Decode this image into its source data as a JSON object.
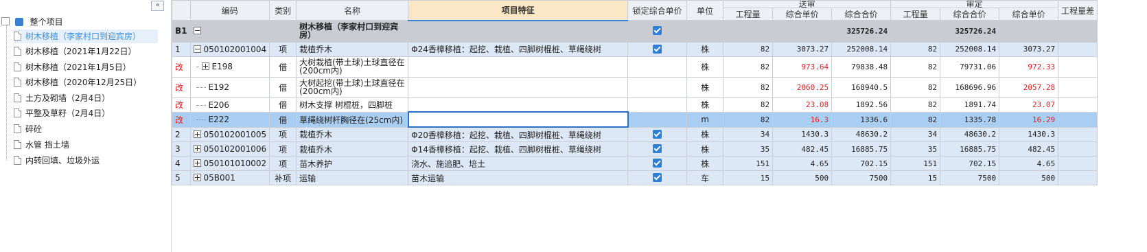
{
  "tree": {
    "collapse_glyph": "«",
    "root": "整个项目",
    "items": [
      "树木移植（李家村口到迎宾房）",
      "树木移植（2021年1月22日）",
      "树木移植（2021年1月5日）",
      "树木移植（2020年12月25日）",
      "土方及砌墙（2月4日）",
      "平整及草籽（2月4日）",
      "碎砼",
      "水管 挡土墙",
      "内转回填、垃圾外运"
    ]
  },
  "grid": {
    "headers": {
      "code": "编码",
      "type": "类别",
      "name": "名称",
      "feature": "项目特征",
      "lock": "锁定综合单价",
      "unit": "单位",
      "group1": "送审",
      "group2": "审定",
      "qty": "工程量",
      "uprice": "综合单价",
      "total": "综合合价",
      "extra": "工程量差"
    },
    "b1": {
      "code": "B1",
      "name": "树木移植（李家村口到迎宾房）",
      "total1": "325726.24",
      "total2": "325726.24"
    },
    "rows": [
      {
        "no": "1",
        "code": "050102001004",
        "type": "项",
        "name": "栽植乔木",
        "feature": "Φ24香樟移植：起挖、栽植、四脚树棍桩、草绳绕树",
        "unit": "株",
        "q1": "82",
        "p1": "3073.27",
        "t1": "252008.14",
        "q2": "82",
        "t2": "252008.14",
        "p2": "3073.27"
      },
      {
        "no": "改",
        "code": "E198",
        "type": "借",
        "name": "大树栽植(带土球)土球直径在(200cm内)",
        "feature": "",
        "unit": "株",
        "q1": "82",
        "p1": "973.64",
        "t1": "79838.48",
        "q2": "82",
        "t2": "79731.06",
        "p2": "972.33"
      },
      {
        "no": "改",
        "code": "E192",
        "type": "借",
        "name": "大树起挖(带土球)土球直径在(200cm内)",
        "feature": "",
        "unit": "株",
        "q1": "82",
        "p1": "2060.25",
        "t1": "168940.5",
        "q2": "82",
        "t2": "168696.96",
        "p2": "2057.28"
      },
      {
        "no": "改",
        "code": "E206",
        "type": "借",
        "name": "树木支撑 树棍桩，四脚桩",
        "feature": "",
        "unit": "株",
        "q1": "82",
        "p1": "23.08",
        "t1": "1892.56",
        "q2": "82",
        "t2": "1891.74",
        "p2": "23.07"
      },
      {
        "no": "改",
        "code": "E222",
        "type": "借",
        "name": "草绳绕树杆胸径在(25cm内)",
        "feature": "",
        "unit": "m",
        "q1": "82",
        "p1": "16.3",
        "t1": "1336.6",
        "q2": "82",
        "t2": "1335.78",
        "p2": "16.29"
      },
      {
        "no": "2",
        "code": "050102001005",
        "type": "项",
        "name": "栽植乔木",
        "feature": "Φ20香樟移植：起挖、栽植、四脚树棍桩、草绳绕树",
        "unit": "株",
        "q1": "34",
        "p1": "1430.3",
        "t1": "48630.2",
        "q2": "34",
        "t2": "48630.2",
        "p2": "1430.3"
      },
      {
        "no": "3",
        "code": "050102001006",
        "type": "项",
        "name": "栽植乔木",
        "feature": "Φ14香樟移植：起挖、栽植、四脚树棍桩、草绳绕树",
        "unit": "株",
        "q1": "35",
        "p1": "482.45",
        "t1": "16885.75",
        "q2": "35",
        "t2": "16885.75",
        "p2": "482.45"
      },
      {
        "no": "4",
        "code": "050101010002",
        "type": "项",
        "name": "苗木养护",
        "feature": "浇水、施追肥、培土",
        "unit": "株",
        "q1": "151",
        "p1": "4.65",
        "t1": "702.15",
        "q2": "151",
        "t2": "702.15",
        "p2": "4.65"
      },
      {
        "no": "5",
        "code": "05B001",
        "type": "补项",
        "name": "运输",
        "feature": "苗木运输",
        "unit": "车",
        "q1": "15",
        "p1": "500",
        "t1": "7500",
        "q2": "15",
        "t2": "7500",
        "p2": "500"
      }
    ]
  }
}
